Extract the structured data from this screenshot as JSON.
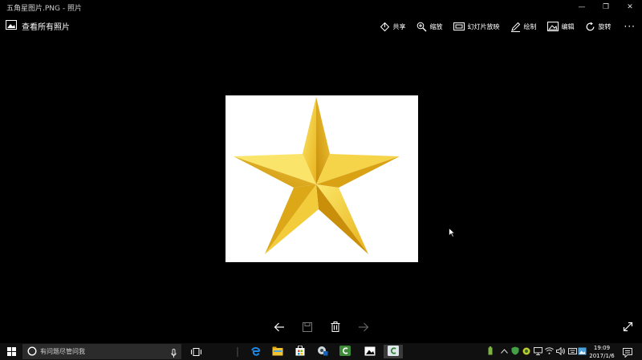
{
  "window": {
    "title": "五角星图片.PNG - 照片",
    "minimize_glyph": "—",
    "maximize_glyph": "❐",
    "close_glyph": "✕"
  },
  "toolbar": {
    "view_all_label": "查看所有照片",
    "actions": [
      {
        "label": "共享",
        "icon": "share-icon"
      },
      {
        "label": "缩放",
        "icon": "zoom-icon"
      },
      {
        "label": "幻灯片放映",
        "icon": "slideshow-icon"
      },
      {
        "label": "绘制",
        "icon": "draw-icon"
      },
      {
        "label": "编辑",
        "icon": "edit-icon"
      },
      {
        "label": "旋转",
        "icon": "rotate-icon"
      }
    ],
    "more_glyph": "···"
  },
  "photo": {
    "subject": "gold-star-icon",
    "colors": {
      "light": "#f8e04a",
      "mid": "#e9b820",
      "dark": "#c9900a",
      "background": "#ffffff"
    }
  },
  "navigation": {
    "buttons": [
      "back-arrow-icon",
      "save-icon",
      "delete-icon",
      "forward-arrow-icon",
      "fullscreen-icon"
    ]
  },
  "taskbar": {
    "search_placeholder": "有问题尽管问我",
    "apps": [
      "task-view-icon",
      "edge-icon",
      "file-explorer-icon",
      "store-icon",
      "media-icon",
      "camtasia-icon",
      "photos-icon",
      "camtasia-recorder-icon"
    ],
    "tray_icons": [
      "battery-icon",
      "chevron-up-icon",
      "shield-icon",
      "app-tray-icon",
      "network-icon",
      "wifi-icon",
      "volume-icon",
      "keyboard-icon",
      "photos-tray-icon"
    ],
    "clock": {
      "time": "19:09",
      "date": "2017/1/6"
    }
  }
}
